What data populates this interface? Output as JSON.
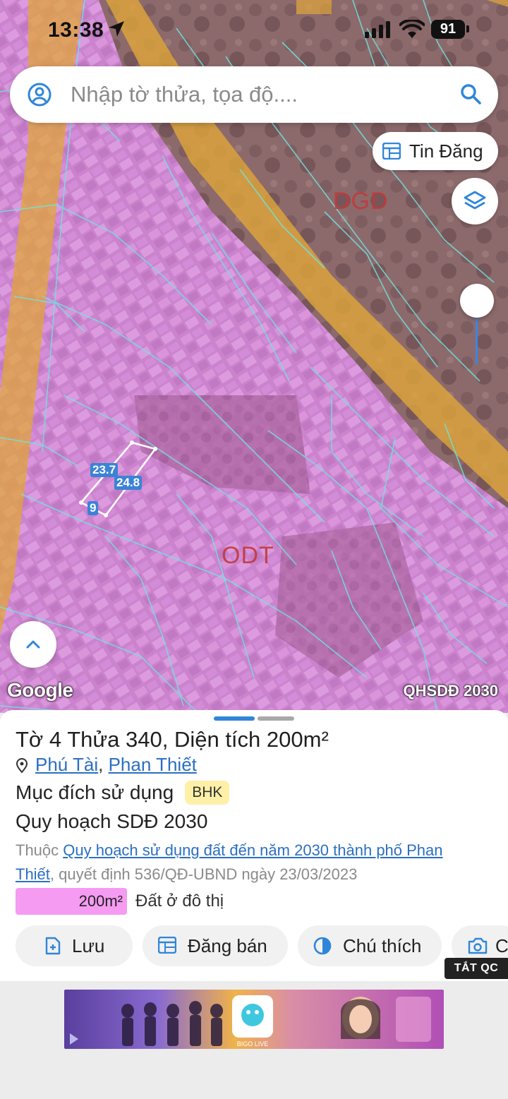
{
  "status_bar": {
    "time": "13:38",
    "battery": "91"
  },
  "search": {
    "placeholder": "Nhập tờ thửa, tọa độ...."
  },
  "map": {
    "tin_dang_label": "Tin Đăng",
    "google_label": "Google",
    "layer_label": "QHSDĐ 2030",
    "zones": [
      "DGD",
      "ODT"
    ],
    "parcel_dimensions": [
      "23.7",
      "24.8",
      "9"
    ]
  },
  "parcel": {
    "title_prefix": "Tờ ",
    "sheet_no": "4",
    "plot_word": " Thửa ",
    "plot_no": "340",
    "area_word": ", Diện tích ",
    "area": "200m²",
    "ward": "Phú Tài",
    "separator": ", ",
    "city": "Phan Thiết",
    "purpose_label": "Mục đích sử dụng",
    "purpose_code": "BHK",
    "plan_title": "Quy hoạch SDĐ 2030",
    "plan_prefix": "Thuộc ",
    "plan_link": "Quy hoạch sử dụng đất đến năm 2030 thành phố Phan Thiết",
    "plan_suffix": ", quyết định 536/QĐ-UBND ngày 23/03/2023",
    "area_value": "200m²",
    "area_type": "Đất ở đô thị",
    "area_color": "#f59bf2"
  },
  "actions": {
    "save": "Lưu",
    "post_sale": "Đăng bán",
    "legend": "Chú thích",
    "capture_partial": "C"
  },
  "ad": {
    "close_label": "TẮT QC",
    "brand": "BIGO LIVE"
  },
  "colors": {
    "accent": "#2f86d9",
    "link": "#2b6fc2",
    "zone_odt": "#d46bd6",
    "road": "#e0a63a"
  }
}
